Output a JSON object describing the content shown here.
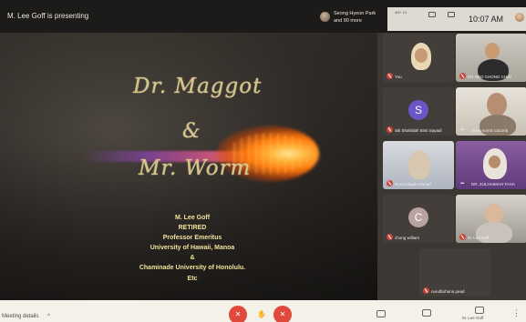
{
  "header": {
    "presenting_text": "M. Lee Goff is presenting",
    "presenter_name": "Seong Hyeon Park",
    "more_count": "and 90 more",
    "time": "10:07 AM",
    "signal_text": "4G+ 21"
  },
  "slide": {
    "title_line1": "Dr. Maggot",
    "title_line2": "&",
    "title_line3": "Mr. Worm",
    "credits": [
      "M. Lee Goff",
      "RETIRED",
      "Professor Emeritus",
      "University of Hawaii, Manoa",
      "&",
      "Chaminade University of Honolulu.",
      "Etc"
    ]
  },
  "participants": [
    {
      "name": "You"
    },
    {
      "name": "DR HEO CHONG CHIN"
    },
    {
      "name": "Siti Shahidah Binti Sayadi",
      "initial": "S",
      "color": "#6a56c8"
    },
    {
      "name": "Tania Ivorra Cazorla"
    },
    {
      "name": "Nurul Atiqah Ahmad"
    },
    {
      "name": "DR. ZULHAIMAH TAHA"
    },
    {
      "name": "chong william",
      "initial": "C",
      "color": "#b9a3a0"
    },
    {
      "name": "M. Lee Goff"
    },
    {
      "name": "nurulfarhana pead"
    }
  ],
  "footer": {
    "meeting_details": "Meeting details",
    "present_label": "M. Lee Goff"
  },
  "colors": {
    "mic_off": "#e0493c",
    "slide_text": "#efe39a",
    "script_text": "#d7c38a"
  }
}
